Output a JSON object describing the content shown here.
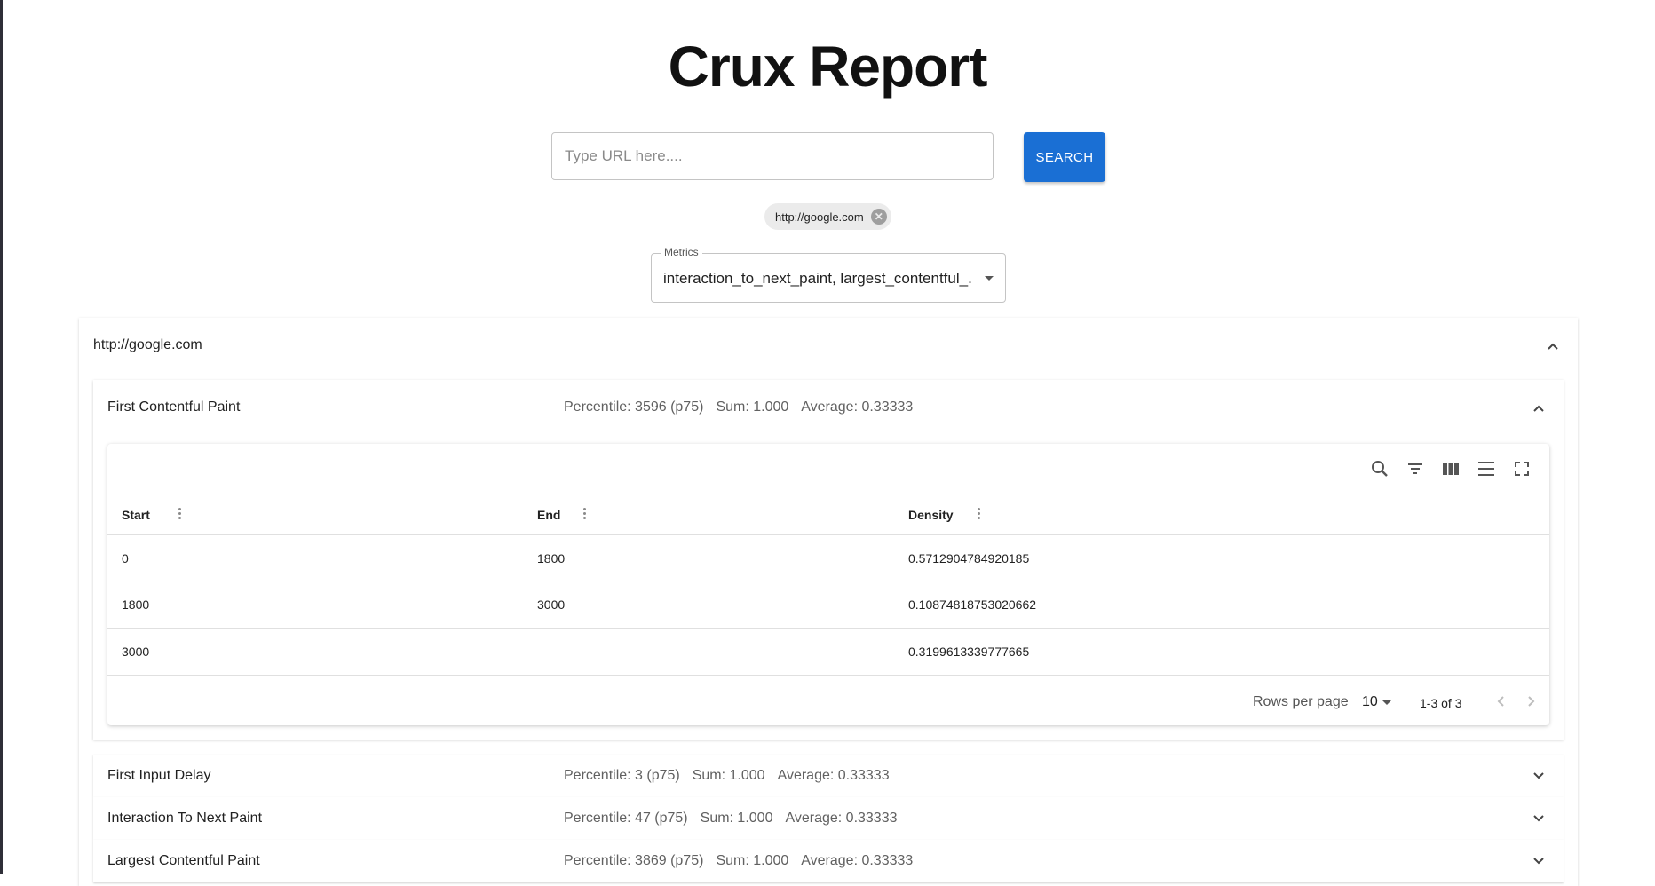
{
  "page": {
    "title": "Crux Report"
  },
  "search": {
    "placeholder": "Type URL here....",
    "value": "",
    "button_label": "SEARCH"
  },
  "chips": [
    {
      "label": "http://google.com",
      "icon": "cancel-icon"
    }
  ],
  "metrics_select": {
    "label": "Metrics",
    "value": "interaction_to_next_paint, largest_contentful_..."
  },
  "panel": {
    "url": "http://google.com",
    "expanded_metric": {
      "name": "First Contentful Paint",
      "percentile": "Percentile: 3596 (p75)",
      "sum": "Sum: 1.000",
      "average": "Average: 0.33333",
      "table": {
        "toolbar_icons": [
          "search-icon",
          "filter-icon",
          "columns-icon",
          "density-icon",
          "fullscreen-icon"
        ],
        "columns": [
          "Start",
          "End",
          "Density"
        ],
        "rows": [
          {
            "start": "0",
            "end": "1800",
            "density": "0.5712904784920185"
          },
          {
            "start": "1800",
            "end": "3000",
            "density": "0.10874818753020662"
          },
          {
            "start": "3000",
            "end": "",
            "density": "0.3199613339777665"
          }
        ],
        "footer": {
          "rows_per_page_label": "Rows per page",
          "rows_per_page": "10",
          "range": "1-3 of 3"
        }
      }
    },
    "collapsed_metrics": [
      {
        "name": "First Input Delay",
        "percentile": "Percentile: 3 (p75)",
        "sum": "Sum: 1.000",
        "average": "Average: 0.33333"
      },
      {
        "name": "Interaction To Next Paint",
        "percentile": "Percentile: 47 (p75)",
        "sum": "Sum: 1.000",
        "average": "Average: 0.33333"
      },
      {
        "name": "Largest Contentful Paint",
        "percentile": "Percentile: 3869 (p75)",
        "sum": "Sum: 1.000",
        "average": "Average: 0.33333"
      }
    ]
  },
  "colors": {
    "primary": "#1a6fd4",
    "chip_bg": "#ebebeb",
    "muted_text": "#616161"
  }
}
